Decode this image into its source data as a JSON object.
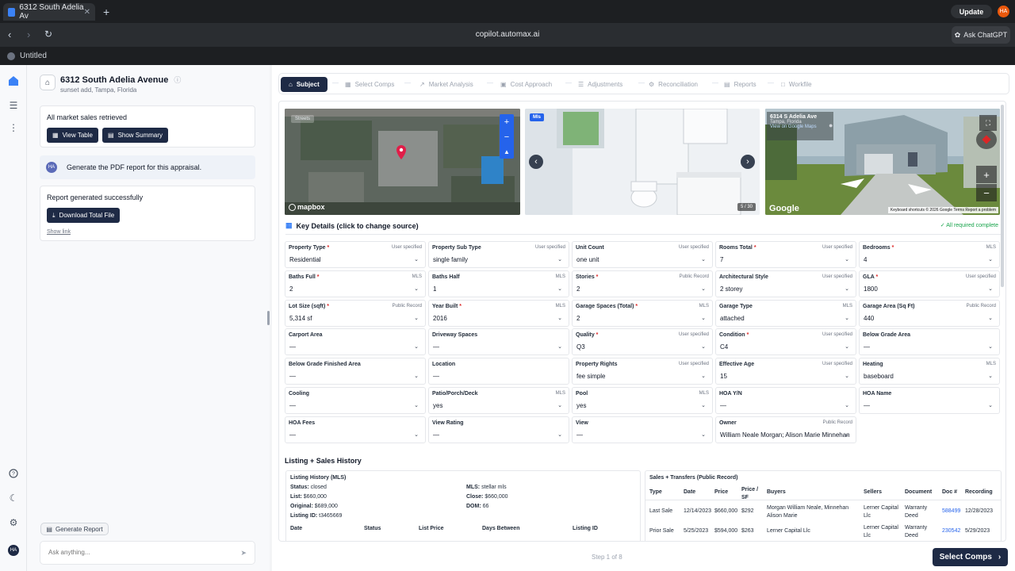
{
  "browser": {
    "tab_title": "6312 South Adelia Av",
    "tab_close": "✕",
    "new_tab": "+",
    "update_label": "Update",
    "profile_initials": "HA",
    "url": "copilot.automax.ai",
    "ask_chatgpt": "Ask ChatGPT",
    "window_title": "Untitled"
  },
  "chat": {
    "property_title": "6312 South Adelia Avenue",
    "property_subtitle": "sunset add, Tampa, Florida",
    "market_msg": "All market sales retrieved",
    "view_table": "View Table",
    "show_summary": "Show Summary",
    "user_initials": "HA",
    "user_msg": "Generate the PDF report for this appraisal.",
    "report_msg": "Report generated successfully",
    "download_label": "Download Total File",
    "show_link": "Show link",
    "generate_report": "Generate Report",
    "ask_placeholder": "Ask anything...",
    "rail_initials": "HA"
  },
  "steps": [
    "Subject",
    "Select Comps",
    "Market Analysis",
    "Cost Approach",
    "Adjustments",
    "Reconciliation",
    "Reports",
    "Workfile"
  ],
  "images": {
    "map_badge": "Streets",
    "map_logo": "mapbox",
    "photo_badge": "Mls",
    "photo_counter": "5 / 30",
    "street_address": "6314 S Adelia Ave",
    "street_city": "Tampa, Florida",
    "street_link": "View on Google Maps",
    "google_logo": "Google",
    "street_footer": "Keyboard shortcuts  © 2026 Google  Terms  Report a problem"
  },
  "key_details": {
    "title": "Key Details (click to change source)",
    "status": "All required complete"
  },
  "fields": [
    {
      "label": "Property Type",
      "req": true,
      "source": "User specified",
      "value": "Residential"
    },
    {
      "label": "Property Sub Type",
      "req": false,
      "source": "User specified",
      "value": "single family"
    },
    {
      "label": "Unit Count",
      "req": false,
      "source": "User specified",
      "value": "one unit"
    },
    {
      "label": "Rooms Total",
      "req": true,
      "source": "User specified",
      "value": "7"
    },
    {
      "label": "Bedrooms",
      "req": true,
      "source": "MLS",
      "value": "4"
    },
    {
      "label": "Baths Full",
      "req": true,
      "source": "MLS",
      "value": "2"
    },
    {
      "label": "Baths Half",
      "req": false,
      "source": "MLS",
      "value": "1"
    },
    {
      "label": "Stories",
      "req": true,
      "source": "Public Record",
      "value": "2"
    },
    {
      "label": "Architectural Style",
      "req": false,
      "source": "User specified",
      "value": "2 storey"
    },
    {
      "label": "GLA",
      "req": true,
      "source": "User specified",
      "value": "1800"
    },
    {
      "label": "Lot Size (sqft)",
      "req": true,
      "source": "Public Record",
      "value": "5,314 sf"
    },
    {
      "label": "Year Built",
      "req": true,
      "source": "MLS",
      "value": "2016"
    },
    {
      "label": "Garage Spaces (Total)",
      "req": true,
      "source": "MLS",
      "value": "2"
    },
    {
      "label": "Garage Type",
      "req": false,
      "source": "MLS",
      "value": "attached"
    },
    {
      "label": "Garage Area (Sq Ft)",
      "req": false,
      "source": "Public Record",
      "value": "440"
    },
    {
      "label": "Carport Area",
      "req": false,
      "source": "",
      "value": "—"
    },
    {
      "label": "Driveway Spaces",
      "req": false,
      "source": "",
      "value": "—"
    },
    {
      "label": "Quality",
      "req": true,
      "source": "User specified",
      "value": "Q3"
    },
    {
      "label": "Condition",
      "req": true,
      "source": "User specified",
      "value": "C4"
    },
    {
      "label": "Below Grade Area",
      "req": false,
      "source": "",
      "value": "—"
    },
    {
      "label": "Below Grade Finished Area",
      "req": false,
      "source": "",
      "value": "—"
    },
    {
      "label": "Location",
      "req": false,
      "source": "",
      "value": "—"
    },
    {
      "label": "Property Rights",
      "req": false,
      "source": "User specified",
      "value": "fee simple"
    },
    {
      "label": "Effective Age",
      "req": false,
      "source": "User specified",
      "value": "15"
    },
    {
      "label": "Heating",
      "req": false,
      "source": "MLS",
      "value": "baseboard"
    },
    {
      "label": "Cooling",
      "req": false,
      "source": "",
      "value": "—"
    },
    {
      "label": "Patio/Porch/Deck",
      "req": false,
      "source": "MLS",
      "value": "yes"
    },
    {
      "label": "Pool",
      "req": false,
      "source": "MLS",
      "value": "yes"
    },
    {
      "label": "HOA Y/N",
      "req": false,
      "source": "",
      "value": "—"
    },
    {
      "label": "HOA Name",
      "req": false,
      "source": "",
      "value": "—"
    },
    {
      "label": "HOA Fees",
      "req": false,
      "source": "",
      "value": "—"
    },
    {
      "label": "View Rating",
      "req": false,
      "source": "",
      "value": "—"
    },
    {
      "label": "View",
      "req": false,
      "source": "",
      "value": "—"
    },
    {
      "label": "Owner",
      "req": false,
      "source": "Public Record",
      "value": "William Neale Morgan; Alison Marie Minnehan"
    }
  ],
  "history": {
    "section_title": "Listing + Sales History",
    "listing_title": "Listing History (MLS)",
    "status_label": "Status:",
    "status": "closed",
    "list_label": "List:",
    "list": "$660,000",
    "original_label": "Original:",
    "original": "$689,000",
    "listing_id_label": "Listing ID:",
    "listing_id": "t3465669",
    "mls_label": "MLS:",
    "mls": "stellar mls",
    "close_label": "Close:",
    "close": "$660,000",
    "dom_label": "DOM:",
    "dom": "66",
    "listing_cols": [
      "Date",
      "Status",
      "List Price",
      "Days Between",
      "Listing ID"
    ],
    "sales_title": "Sales + Transfers (Public Record)",
    "sales_cols": [
      "Type",
      "Date",
      "Price",
      "Price / SF",
      "Buyers",
      "Sellers",
      "Document",
      "Doc #",
      "Recording"
    ],
    "sales_rows": [
      {
        "type": "Last Sale",
        "date": "12/14/2023",
        "price": "$660,000",
        "psf": "$292",
        "buyers": "Morgan William Neale, Minnehan Alison Marie",
        "sellers": "Lerner Capital Llc",
        "document": "Warranty Deed",
        "doc": "588499",
        "recording": "12/28/2023"
      },
      {
        "type": "Prior Sale",
        "date": "5/25/2023",
        "price": "$594,000",
        "psf": "$263",
        "buyers": "Lerner Capital Llc",
        "sellers": "Lerner Capital Llc",
        "document": "Warranty Deed",
        "doc": "230542",
        "recording": "5/29/2023"
      }
    ]
  },
  "footer": {
    "step_of": "Step 1 of 8",
    "next_label": "Select Comps"
  }
}
